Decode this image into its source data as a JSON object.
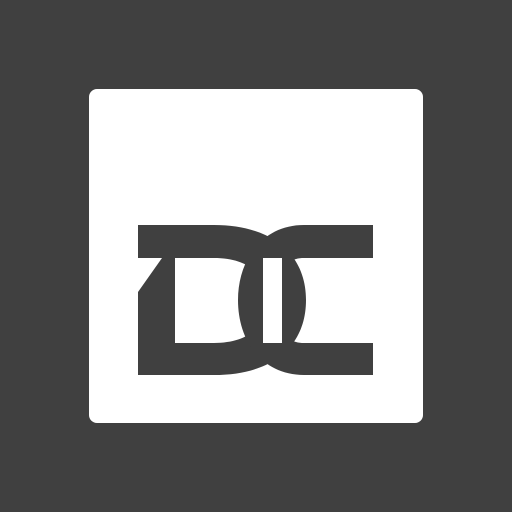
{
  "app_icon": {
    "name": "DC",
    "colors": {
      "background": "#404040",
      "tile": "#ffffff",
      "mark": "#404040"
    },
    "icon": "dc-monogram-icon"
  }
}
